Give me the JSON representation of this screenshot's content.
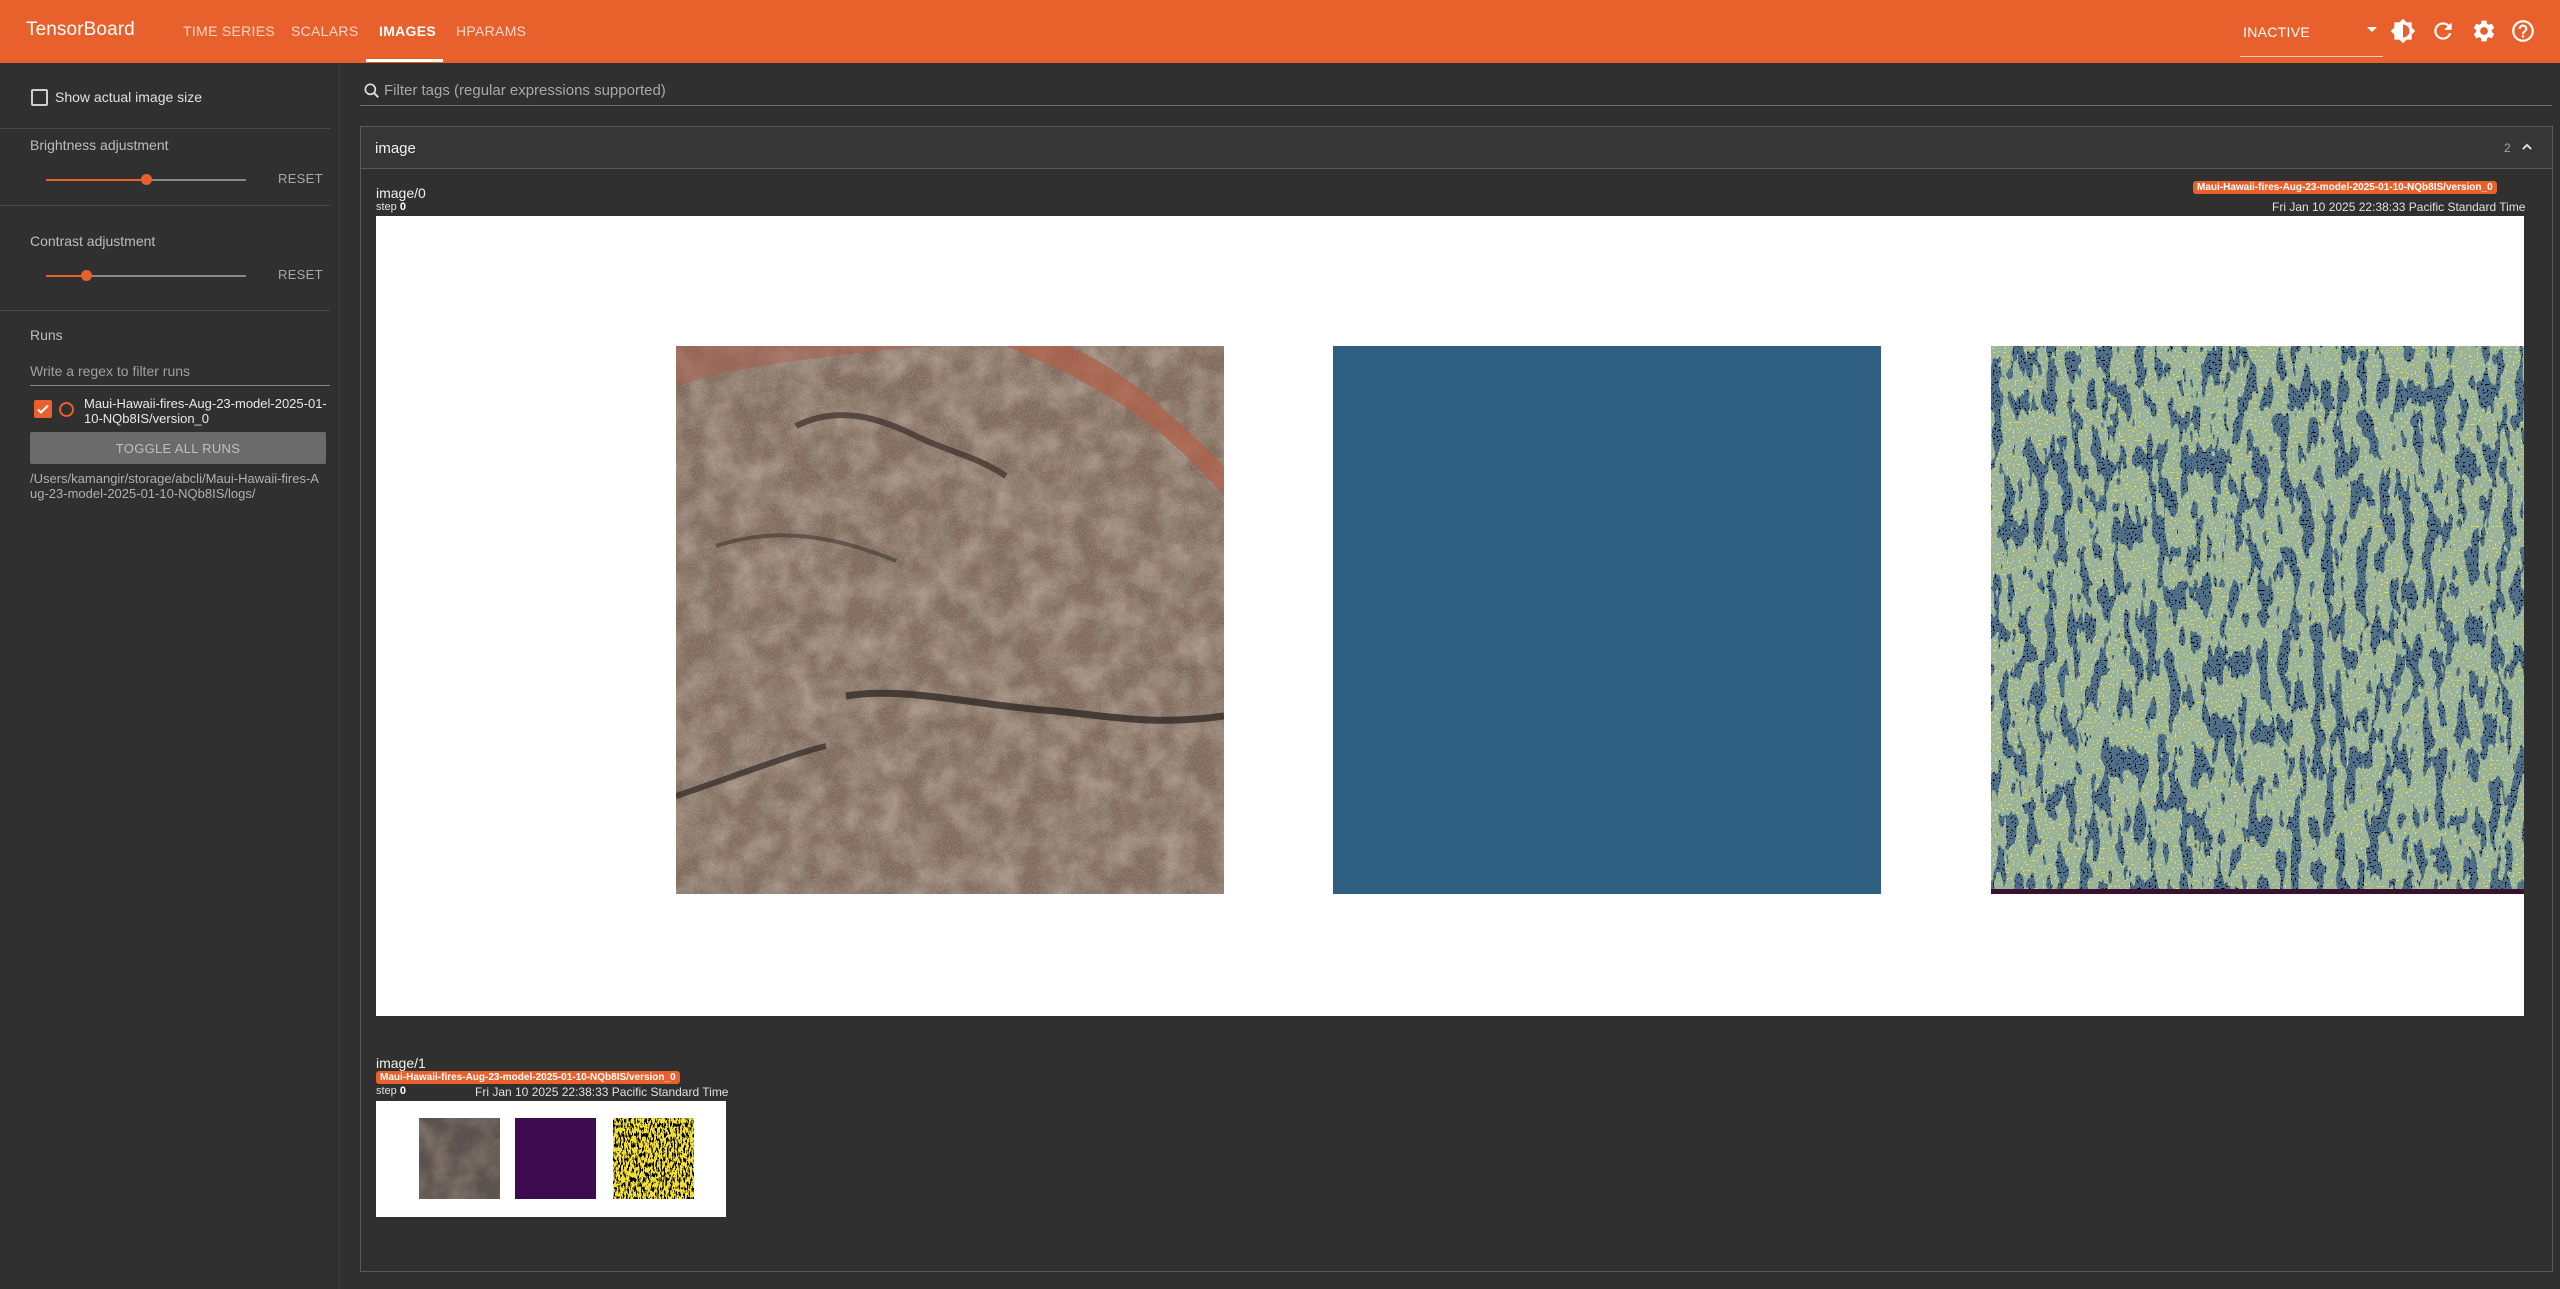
{
  "header": {
    "brand": "TensorBoard",
    "tabs": [
      {
        "label": "TIME SERIES"
      },
      {
        "label": "SCALARS"
      },
      {
        "label": "IMAGES"
      },
      {
        "label": "HPARAMS"
      }
    ],
    "active_tab": "IMAGES",
    "status_select": "INACTIVE",
    "icons": [
      "theme-icon",
      "refresh-icon",
      "settings-icon",
      "help-icon"
    ],
    "accent": "#e8602c"
  },
  "sidebar": {
    "show_actual_size_label": "Show actual image size",
    "brightness_label": "Brightness adjustment",
    "brightness_value": 0.5,
    "contrast_label": "Contrast adjustment",
    "contrast_value": 0.2,
    "reset_label": "RESET",
    "runs_title": "Runs",
    "runs_filter_placeholder": "Write a regex to filter runs",
    "run_name": "Maui-Hawaii-fires-Aug-23-model-2025-01-10-NQb8IS/version_0",
    "toggle_all_label": "TOGGLE ALL RUNS",
    "logdir": "/Users/kamangir/storage/abcli/Maui-Hawaii-fires-Aug-23-model-2025-01-10-NQb8IS/logs/"
  },
  "main": {
    "search_placeholder": "Filter tags (regular expressions supported)",
    "group": {
      "title": "image",
      "count": "2"
    },
    "cards": [
      {
        "tag": "image/0",
        "step_label": "step",
        "step_value": "0",
        "run": "Maui-Hawaii-fires-Aug-23-model-2025-01-10-NQb8IS/version_0",
        "timestamp": "Fri Jan 10 2025 22:38:33 Pacific Standard Time"
      },
      {
        "tag": "image/1",
        "step_label": "step",
        "step_value": "0",
        "run": "Maui-Hawaii-fires-Aug-23-model-2025-01-10-NQb8IS/version_0",
        "timestamp": "Fri Jan 10 2025 22:38:33 Pacific Standard Time"
      }
    ]
  }
}
